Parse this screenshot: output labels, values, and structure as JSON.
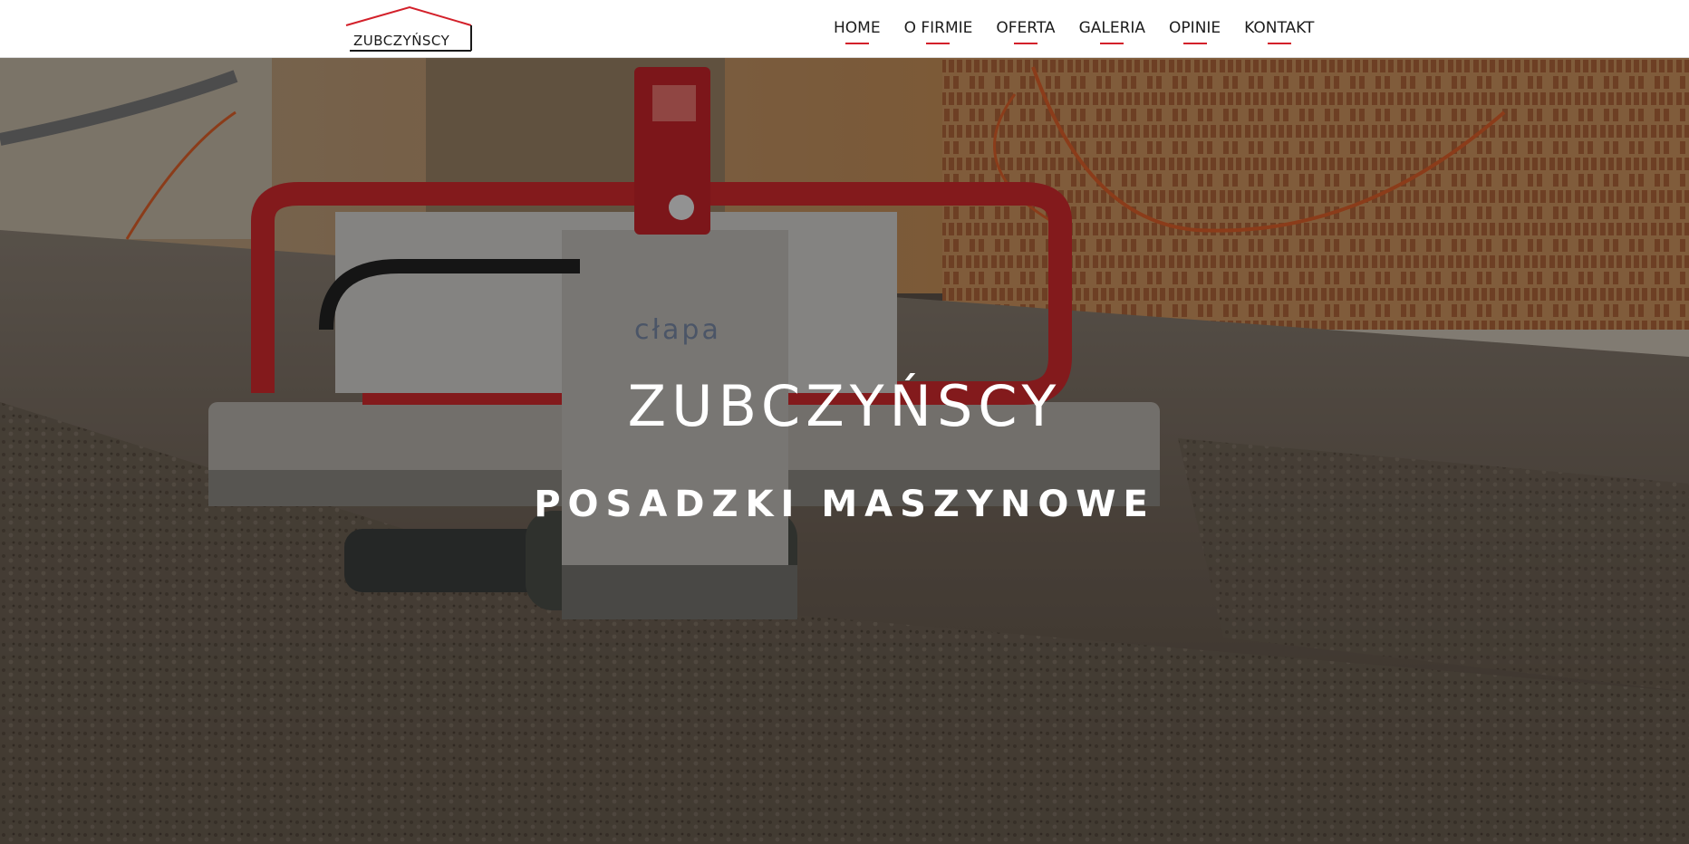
{
  "brand": {
    "logo_text": "ZUBCZYŃSCY",
    "accent_color": "#d3202a"
  },
  "nav": {
    "items": [
      {
        "label": "HOME"
      },
      {
        "label": "O FIRMIE"
      },
      {
        "label": "OFERTA"
      },
      {
        "label": "GALERIA"
      },
      {
        "label": "OPINIE"
      },
      {
        "label": "KONTAKT"
      }
    ]
  },
  "hero": {
    "title": "ZUBCZYŃSCY",
    "subtitle": "POSADZKI MASZYNOWE",
    "background_image": "floor-screeding-machine-photo",
    "machine_label": "cłapa"
  }
}
